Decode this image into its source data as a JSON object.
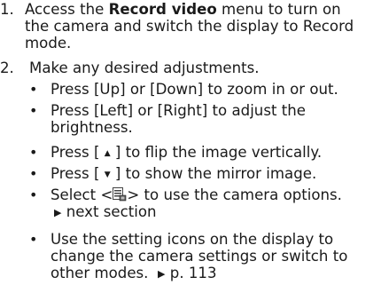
{
  "step1": {
    "number": "1.",
    "prefix": "Access the ",
    "menu": "Record video",
    "line1_suffix": " menu to turn on",
    "line2": "the camera and switch the display to Record",
    "line3": "mode."
  },
  "step2": {
    "number": "2.",
    "text": "Make any desired adjustments."
  },
  "bullets": {
    "zoom": "Press [Up] or [Down] to zoom in or out.",
    "brightness_line1": "Press [Left] or [Right] to adjust the",
    "brightness_line2": "brightness.",
    "flip_before": "Press [ ",
    "flip_after": " ] to flip the image vertically.",
    "mirror_before": "Press [ ",
    "mirror_after": " ] to show the mirror image.",
    "options_before": "Select <",
    "options_after": "> to use the camera options.",
    "options_ref": "next section",
    "settings_line1": "Use the setting icons on the display to",
    "settings_line2": "change the camera settings or switch to",
    "settings_line3": "other modes.",
    "settings_ref": "p. 113"
  },
  "symbols": {
    "bullet": "•",
    "arrow_right": "▶",
    "key_up": "▲",
    "key_down": "▼"
  },
  "icons": {
    "menu_icon": "options-menu-icon"
  }
}
